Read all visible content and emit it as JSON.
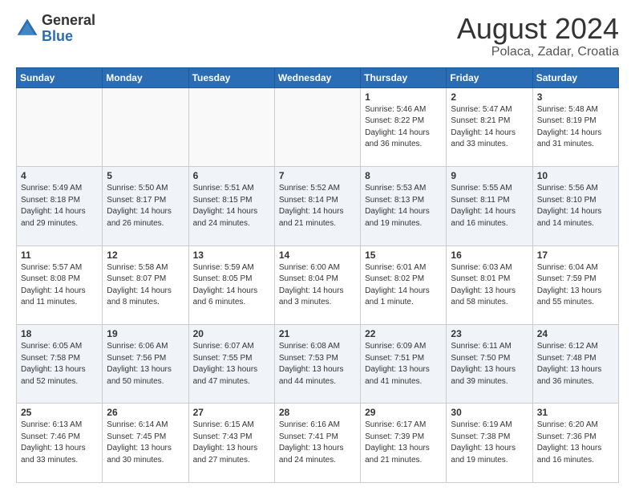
{
  "logo": {
    "general": "General",
    "blue": "Blue"
  },
  "title": "August 2024",
  "subtitle": "Polaca, Zadar, Croatia",
  "weekdays": [
    "Sunday",
    "Monday",
    "Tuesday",
    "Wednesday",
    "Thursday",
    "Friday",
    "Saturday"
  ],
  "weeks": [
    [
      {
        "day": "",
        "info": ""
      },
      {
        "day": "",
        "info": ""
      },
      {
        "day": "",
        "info": ""
      },
      {
        "day": "",
        "info": ""
      },
      {
        "day": "1",
        "info": "Sunrise: 5:46 AM\nSunset: 8:22 PM\nDaylight: 14 hours\nand 36 minutes."
      },
      {
        "day": "2",
        "info": "Sunrise: 5:47 AM\nSunset: 8:21 PM\nDaylight: 14 hours\nand 33 minutes."
      },
      {
        "day": "3",
        "info": "Sunrise: 5:48 AM\nSunset: 8:19 PM\nDaylight: 14 hours\nand 31 minutes."
      }
    ],
    [
      {
        "day": "4",
        "info": "Sunrise: 5:49 AM\nSunset: 8:18 PM\nDaylight: 14 hours\nand 29 minutes."
      },
      {
        "day": "5",
        "info": "Sunrise: 5:50 AM\nSunset: 8:17 PM\nDaylight: 14 hours\nand 26 minutes."
      },
      {
        "day": "6",
        "info": "Sunrise: 5:51 AM\nSunset: 8:15 PM\nDaylight: 14 hours\nand 24 minutes."
      },
      {
        "day": "7",
        "info": "Sunrise: 5:52 AM\nSunset: 8:14 PM\nDaylight: 14 hours\nand 21 minutes."
      },
      {
        "day": "8",
        "info": "Sunrise: 5:53 AM\nSunset: 8:13 PM\nDaylight: 14 hours\nand 19 minutes."
      },
      {
        "day": "9",
        "info": "Sunrise: 5:55 AM\nSunset: 8:11 PM\nDaylight: 14 hours\nand 16 minutes."
      },
      {
        "day": "10",
        "info": "Sunrise: 5:56 AM\nSunset: 8:10 PM\nDaylight: 14 hours\nand 14 minutes."
      }
    ],
    [
      {
        "day": "11",
        "info": "Sunrise: 5:57 AM\nSunset: 8:08 PM\nDaylight: 14 hours\nand 11 minutes."
      },
      {
        "day": "12",
        "info": "Sunrise: 5:58 AM\nSunset: 8:07 PM\nDaylight: 14 hours\nand 8 minutes."
      },
      {
        "day": "13",
        "info": "Sunrise: 5:59 AM\nSunset: 8:05 PM\nDaylight: 14 hours\nand 6 minutes."
      },
      {
        "day": "14",
        "info": "Sunrise: 6:00 AM\nSunset: 8:04 PM\nDaylight: 14 hours\nand 3 minutes."
      },
      {
        "day": "15",
        "info": "Sunrise: 6:01 AM\nSunset: 8:02 PM\nDaylight: 14 hours\nand 1 minute."
      },
      {
        "day": "16",
        "info": "Sunrise: 6:03 AM\nSunset: 8:01 PM\nDaylight: 13 hours\nand 58 minutes."
      },
      {
        "day": "17",
        "info": "Sunrise: 6:04 AM\nSunset: 7:59 PM\nDaylight: 13 hours\nand 55 minutes."
      }
    ],
    [
      {
        "day": "18",
        "info": "Sunrise: 6:05 AM\nSunset: 7:58 PM\nDaylight: 13 hours\nand 52 minutes."
      },
      {
        "day": "19",
        "info": "Sunrise: 6:06 AM\nSunset: 7:56 PM\nDaylight: 13 hours\nand 50 minutes."
      },
      {
        "day": "20",
        "info": "Sunrise: 6:07 AM\nSunset: 7:55 PM\nDaylight: 13 hours\nand 47 minutes."
      },
      {
        "day": "21",
        "info": "Sunrise: 6:08 AM\nSunset: 7:53 PM\nDaylight: 13 hours\nand 44 minutes."
      },
      {
        "day": "22",
        "info": "Sunrise: 6:09 AM\nSunset: 7:51 PM\nDaylight: 13 hours\nand 41 minutes."
      },
      {
        "day": "23",
        "info": "Sunrise: 6:11 AM\nSunset: 7:50 PM\nDaylight: 13 hours\nand 39 minutes."
      },
      {
        "day": "24",
        "info": "Sunrise: 6:12 AM\nSunset: 7:48 PM\nDaylight: 13 hours\nand 36 minutes."
      }
    ],
    [
      {
        "day": "25",
        "info": "Sunrise: 6:13 AM\nSunset: 7:46 PM\nDaylight: 13 hours\nand 33 minutes."
      },
      {
        "day": "26",
        "info": "Sunrise: 6:14 AM\nSunset: 7:45 PM\nDaylight: 13 hours\nand 30 minutes."
      },
      {
        "day": "27",
        "info": "Sunrise: 6:15 AM\nSunset: 7:43 PM\nDaylight: 13 hours\nand 27 minutes."
      },
      {
        "day": "28",
        "info": "Sunrise: 6:16 AM\nSunset: 7:41 PM\nDaylight: 13 hours\nand 24 minutes."
      },
      {
        "day": "29",
        "info": "Sunrise: 6:17 AM\nSunset: 7:39 PM\nDaylight: 13 hours\nand 21 minutes."
      },
      {
        "day": "30",
        "info": "Sunrise: 6:19 AM\nSunset: 7:38 PM\nDaylight: 13 hours\nand 19 minutes."
      },
      {
        "day": "31",
        "info": "Sunrise: 6:20 AM\nSunset: 7:36 PM\nDaylight: 13 hours\nand 16 minutes."
      }
    ]
  ]
}
